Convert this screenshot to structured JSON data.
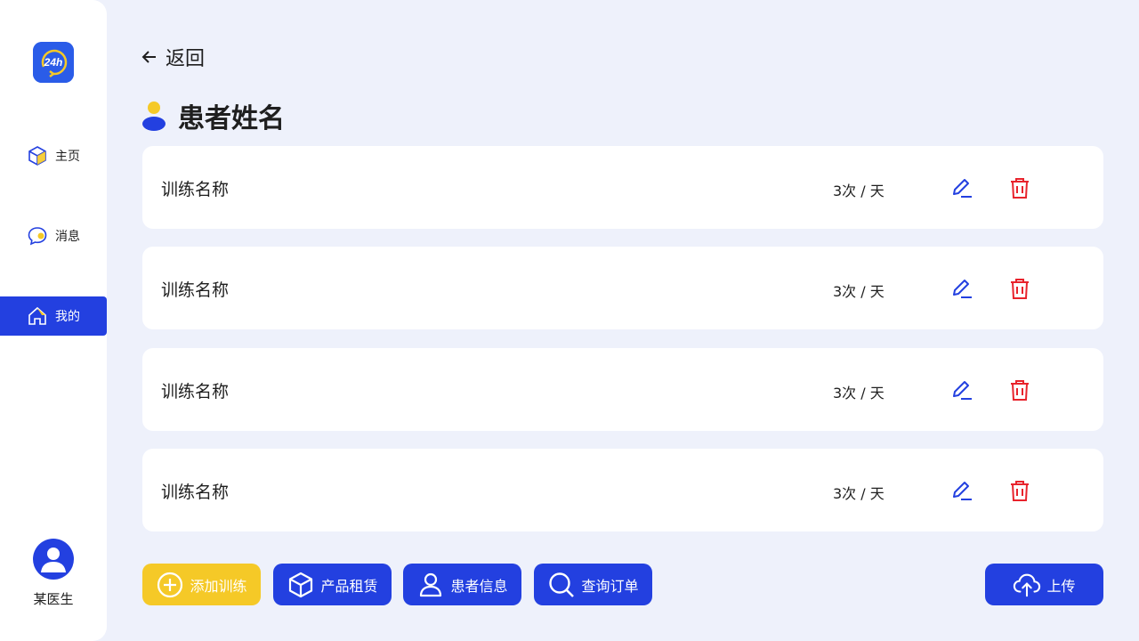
{
  "sidebar": {
    "logo_text": "24h",
    "nav": [
      {
        "label": "主页",
        "icon": "box-icon"
      },
      {
        "label": "消息",
        "icon": "chat-icon"
      },
      {
        "label": "我的",
        "icon": "home-icon",
        "active": true
      }
    ],
    "doctor_name": "某医生"
  },
  "header": {
    "back_label": "返回",
    "patient_name": "患者姓名"
  },
  "trainings": [
    {
      "name": "训练名称",
      "frequency": "3次 / 天"
    },
    {
      "name": "训练名称",
      "frequency": "3次 / 天"
    },
    {
      "name": "训练名称",
      "frequency": "3次 / 天"
    },
    {
      "name": "训练名称",
      "frequency": "3次 / 天"
    }
  ],
  "actions": {
    "add_training": "添加训练",
    "product_rental": "产品租赁",
    "patient_info": "患者信息",
    "query_orders": "查询订单",
    "upload": "上传"
  },
  "colors": {
    "primary": "#2340e0",
    "accent_yellow": "#f5c927",
    "delete_red": "#e8232c",
    "background": "#eef1fb"
  }
}
